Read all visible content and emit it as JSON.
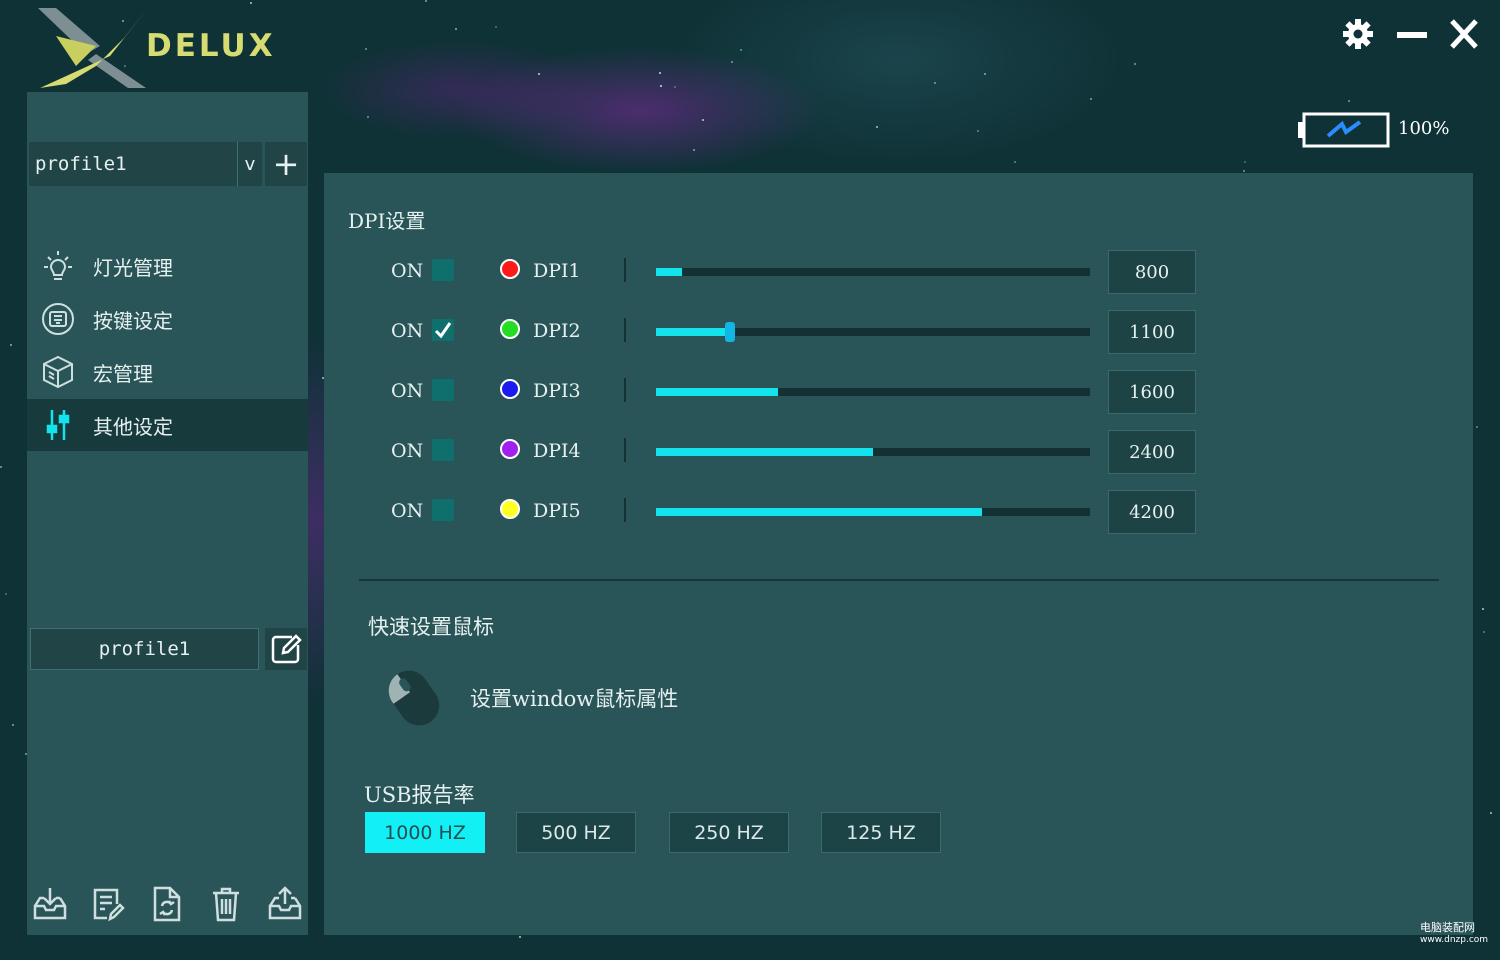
{
  "app": {
    "brand": "DELUX",
    "battery_level": "100%",
    "accent_color": "#12e3ec"
  },
  "sidebar": {
    "profile_select": {
      "value": "profile1",
      "dropdown_glyph": "v",
      "add_glyph": "+"
    },
    "nav": [
      {
        "label": "灯光管理",
        "icon": "lightbulb-icon",
        "active": false
      },
      {
        "label": "按键设定",
        "icon": "keypad-icon",
        "active": false
      },
      {
        "label": "宏管理",
        "icon": "cube-icon",
        "active": false
      },
      {
        "label": "其他设定",
        "icon": "sliders-icon",
        "active": true
      }
    ],
    "profile_name": "profile1",
    "tools": [
      "import-icon",
      "notes-icon",
      "reset-icon",
      "trash-icon",
      "export-icon"
    ]
  },
  "dpi": {
    "title": "DPI设置",
    "on_label": "ON",
    "rows": [
      {
        "name": "DPI1",
        "value": "800",
        "checked": false,
        "color": "#ff1a1a",
        "level": 0.06
      },
      {
        "name": "DPI2",
        "value": "1100",
        "checked": true,
        "color": "#22dd22",
        "level": 0.17
      },
      {
        "name": "DPI3",
        "value": "1600",
        "checked": false,
        "color": "#1b1bf0",
        "level": 0.28
      },
      {
        "name": "DPI4",
        "value": "2400",
        "checked": false,
        "color": "#a020f0",
        "level": 0.5
      },
      {
        "name": "DPI5",
        "value": "4200",
        "checked": false,
        "color": "#ffff22",
        "level": 0.75
      }
    ]
  },
  "quick": {
    "title": "快速设置鼠标",
    "link": "设置window鼠标属性"
  },
  "usb": {
    "title": "USB报告率",
    "options": [
      {
        "label": "1000 HZ",
        "selected": true
      },
      {
        "label": "500 HZ",
        "selected": false
      },
      {
        "label": "250 HZ",
        "selected": false
      },
      {
        "label": "125 HZ",
        "selected": false
      }
    ]
  },
  "watermark": {
    "line1": "电脑装配网",
    "line2": "www.dnzp.com"
  }
}
